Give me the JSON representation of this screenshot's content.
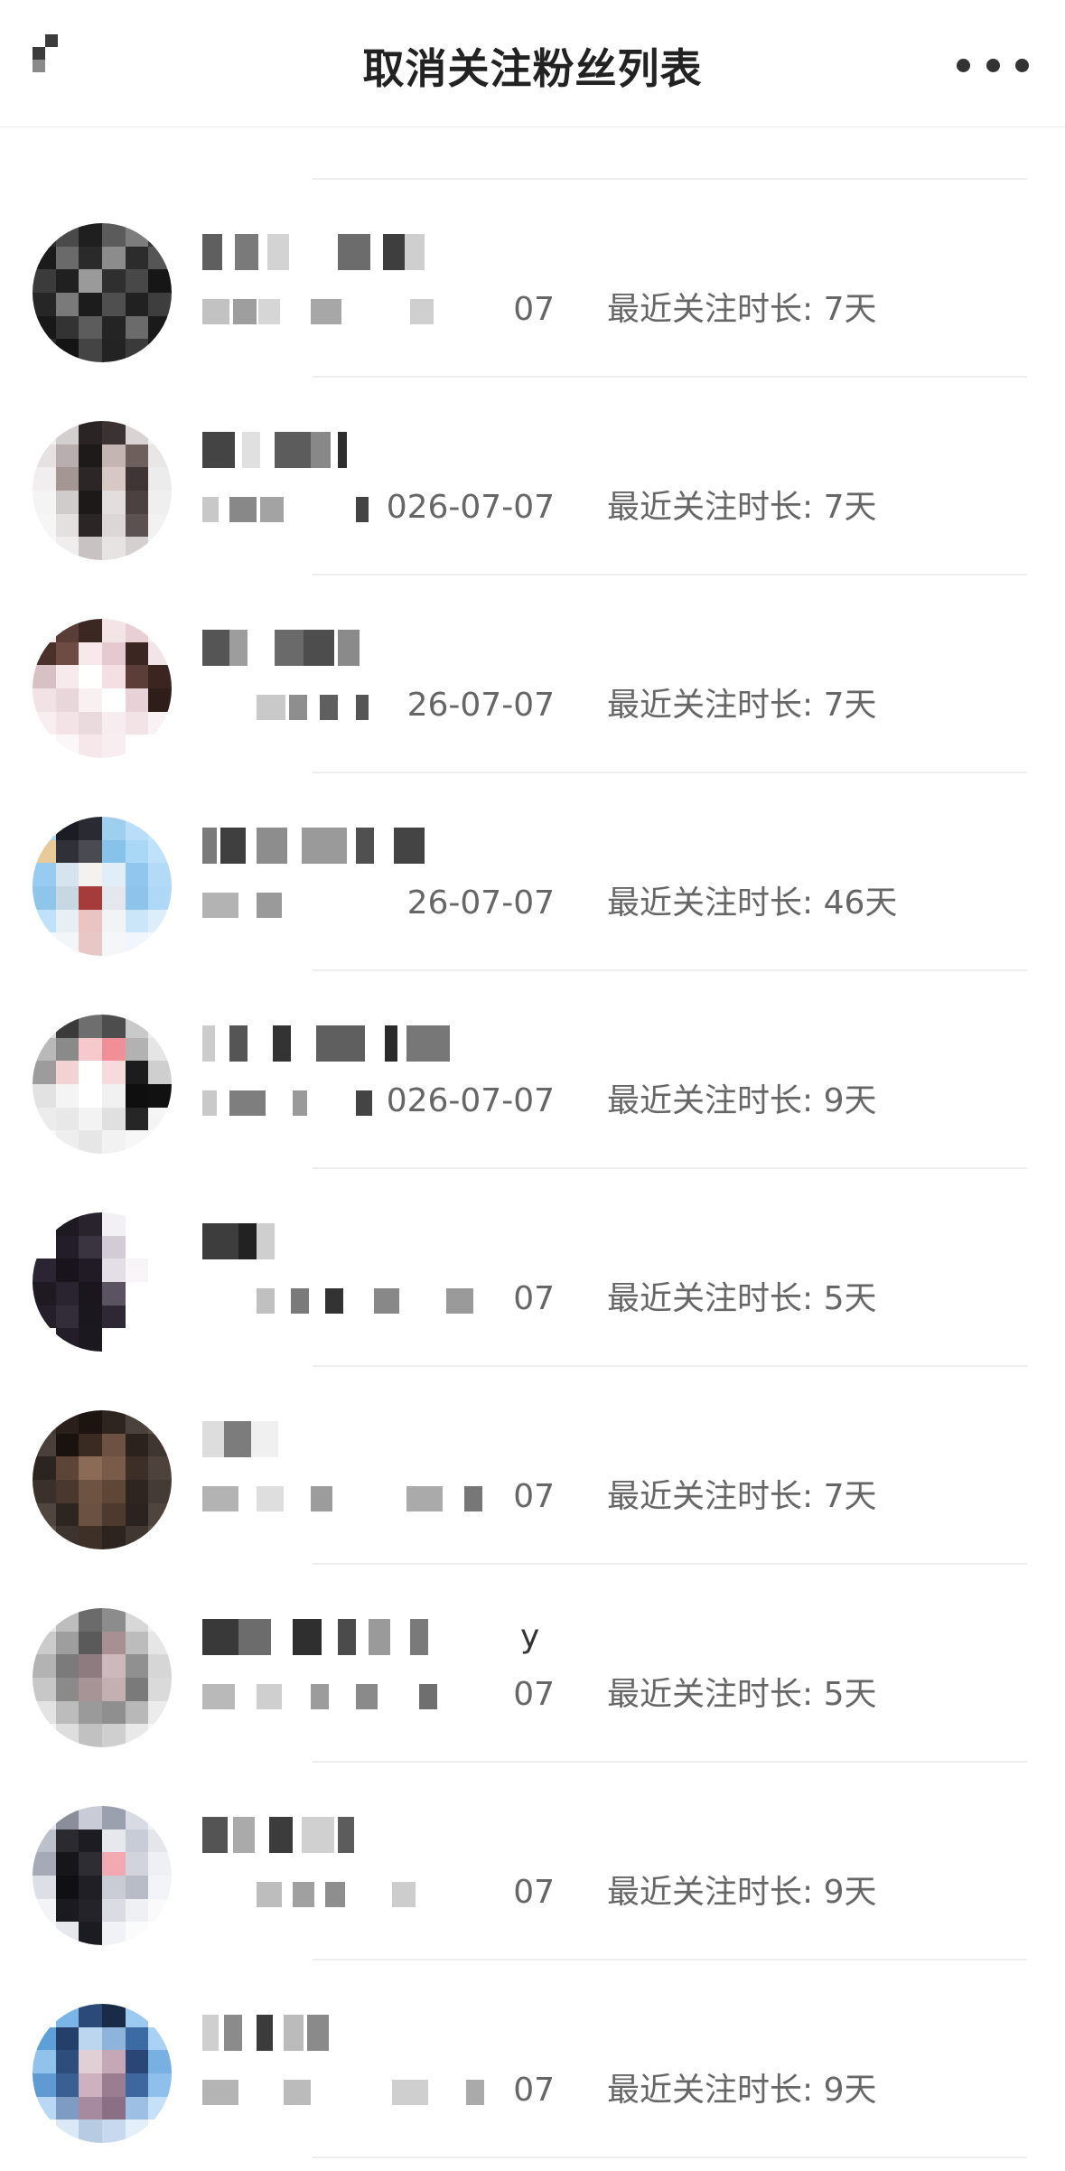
{
  "header": {
    "title": "取消关注粉丝列表"
  },
  "follow_label": "最近关注时长: ",
  "rows": [
    {
      "date": "",
      "days": "",
      "name_tail": "",
      "avatar": [
        "#f3e9f1",
        "#e8c6dc",
        "#d9a6c8",
        "#cfa5c3",
        "#f1dbe9",
        "#ffffff",
        "#f0d8e6",
        "#e22e86",
        "#d7a4c8",
        "#cba0c0",
        "#e6c6db",
        "#ffffff",
        "#ffffff",
        "#ffffff",
        "#ffffff",
        "#ffffff",
        "#ffffff",
        "#ffffff",
        "#ffffff",
        "#ffffff",
        "#ffffff",
        "#ffffff",
        "#ffffff",
        "#ffffff",
        "#ffffff",
        "#ffffff",
        "#ffffff",
        "#ffffff",
        "#ffffff",
        "#ffffff",
        "#ffffff",
        "#ffffff",
        "#ffffff",
        "#ffffff",
        "#ffffff",
        "#ffffff"
      ]
    },
    {
      "date": "07",
      "days": "7天",
      "name_tail": "",
      "avatar": [
        "#2d2d2d",
        "#4a4a4a",
        "#1f1f1f",
        "#5b5b5b",
        "#7d7d7d",
        "#3a3a3a",
        "#1b1b1b",
        "#6a6a6a",
        "#2a2a2a",
        "#8c8c8c",
        "#2c2c2c",
        "#555555",
        "#3b3b3b",
        "#202020",
        "#9a9a9a",
        "#2f2f2f",
        "#484848",
        "#161616",
        "#262626",
        "#7a7a7a",
        "#1c1c1c",
        "#4f4f4f",
        "#212121",
        "#3e3e3e",
        "#181818",
        "#333333",
        "#5c5c5c",
        "#242424",
        "#6b6b6b",
        "#1a1a1a",
        "#2b2b2b",
        "#141414",
        "#444444",
        "#232323",
        "#3a3a3a",
        "#1d1d1d"
      ]
    },
    {
      "date": "026-07-07",
      "days": "7天",
      "name_tail": "",
      "avatar": [
        "#efefef",
        "#d4cfcf",
        "#2a2424",
        "#3b3232",
        "#d9d3d3",
        "#f2f2f2",
        "#e6e2e2",
        "#b9aeae",
        "#1e1a1a",
        "#c4b5b2",
        "#6d5f5c",
        "#e9e6e6",
        "#f0eeee",
        "#a39693",
        "#2d2626",
        "#d7c8c4",
        "#3f3535",
        "#ececec",
        "#f4f4f4",
        "#d1cccc",
        "#1d1919",
        "#e3dede",
        "#4b4141",
        "#efefef",
        "#f6f6f6",
        "#e4e0e0",
        "#2b2525",
        "#dcd6d6",
        "#5c5151",
        "#f2f2f2",
        "#f8f8f8",
        "#efeded",
        "#c9c2c2",
        "#e7e3e3",
        "#d5d0d0",
        "#f5f5f5"
      ]
    },
    {
      "date": "26-07-07",
      "days": "7天",
      "name_tail": "",
      "avatar": [
        "#f5eaea",
        "#5a3d36",
        "#3c2822",
        "#f3e4e6",
        "#e7cfd4",
        "#f9f3f4",
        "#4a302a",
        "#6e4c43",
        "#f6e8eb",
        "#e4c9ce",
        "#3b2621",
        "#f2e5e7",
        "#d8c1c5",
        "#f7eaed",
        "#ffffff",
        "#f4e0e4",
        "#5b3e37",
        "#3a2520",
        "#f1e2e5",
        "#e9d6da",
        "#f9f0f2",
        "#ffffff",
        "#e7d2d7",
        "#2e1d19",
        "#f8eef0",
        "#f4e3e6",
        "#eadade",
        "#f7ecef",
        "#f2e3e6",
        "#f9f1f3",
        "#ffffff",
        "#fbf6f7",
        "#f5e7ea",
        "#f8eef1",
        "#ffffff",
        "#ffffff"
      ]
    },
    {
      "date": "26-07-07",
      "days": "46天",
      "name_tail": "",
      "avatar": [
        "#a7d6f2",
        "#1c1c24",
        "#2a2a33",
        "#9fcfee",
        "#b8defa",
        "#c4e5fb",
        "#e8c99a",
        "#303038",
        "#4a4a52",
        "#87c2ea",
        "#a9d7f6",
        "#bfe2fa",
        "#96ccef",
        "#d6e4ef",
        "#f4f1ef",
        "#e2eef7",
        "#91c7ec",
        "#b3dbf8",
        "#8fc5ea",
        "#c8d8e3",
        "#a73a3a",
        "#e4e8ec",
        "#8ec4ea",
        "#aed8f6",
        "#bfe1f9",
        "#e7eef4",
        "#eac4c2",
        "#f2f3f4",
        "#cbe5f9",
        "#ddeefb",
        "#f2f8fd",
        "#f3f6f9",
        "#e8c8c6",
        "#f4f6f8",
        "#f0f6fb",
        "#f6f9fc"
      ]
    },
    {
      "date": "026-07-07",
      "days": "9天",
      "name_tail": "",
      "avatar": [
        "#dadada",
        "#3a3a3a",
        "#6e6e6e",
        "#4d4d4d",
        "#c9c9c9",
        "#eeeeee",
        "#b9b9b9",
        "#8a8a8a",
        "#f6c9cc",
        "#f08f98",
        "#b2b2b2",
        "#e5e5e5",
        "#9c9c9c",
        "#f3d2d4",
        "#ffffff",
        "#f7dadc",
        "#1c1c1c",
        "#cfcfcf",
        "#e2e2e2",
        "#f4f4f4",
        "#ffffff",
        "#f1f1f1",
        "#0f0f0f",
        "#111111",
        "#ececec",
        "#e8e8e8",
        "#f3f3f3",
        "#e0e0e0",
        "#262626",
        "#f5f5f5",
        "#f9f9f9",
        "#eeeeee",
        "#e6e6e6",
        "#f2f2f2",
        "#f7f7f7",
        "#fbfbfb"
      ]
    },
    {
      "date": "07",
      "days": "5天",
      "name_tail": "",
      "avatar": [
        "#ffffff",
        "#1d1a22",
        "#28232d",
        "#f2f0f3",
        "#ffffff",
        "#ffffff",
        "#ffffff",
        "#221d28",
        "#3a3440",
        "#d3ccd6",
        "#ffffff",
        "#ffffff",
        "#2b2533",
        "#18141c",
        "#201b25",
        "#e4dee6",
        "#f7f5f8",
        "#ffffff",
        "#1e1a22",
        "#2a2430",
        "#1a161d",
        "#5b5361",
        "#ffffff",
        "#ffffff",
        "#241f29",
        "#332c39",
        "#1b171f",
        "#2e2834",
        "#ffffff",
        "#ffffff",
        "#ffffff",
        "#221d27",
        "#1c181f",
        "#ffffff",
        "#ffffff",
        "#ffffff"
      ]
    },
    {
      "date": "07",
      "days": "7天",
      "name_tail": "",
      "avatar": [
        "#3d3530",
        "#2a1f1a",
        "#1c1410",
        "#2e2420",
        "#4b423d",
        "#5a504a",
        "#4a3f39",
        "#1a120e",
        "#3a2a22",
        "#6d5142",
        "#2c221d",
        "#3f3631",
        "#2c2420",
        "#5c4436",
        "#8b6a56",
        "#7a5b49",
        "#3b2f28",
        "#4d423c",
        "#3a312c",
        "#4a372d",
        "#6e5343",
        "#5f4738",
        "#2f2520",
        "#453b35",
        "#51463f",
        "#2d2520",
        "#6a5141",
        "#4d3a2f",
        "#2b2320",
        "#4f443e",
        "#5b504a",
        "#3d3430",
        "#3e2f27",
        "#2d2420",
        "#403632",
        "#5c524c"
      ]
    },
    {
      "date": "07",
      "days": "5天",
      "name_tail": "y",
      "avatar": [
        "#e9e9e9",
        "#bdbdbd",
        "#6b6b6b",
        "#8c8c8c",
        "#d7d7d7",
        "#f3f3f3",
        "#cbcbcb",
        "#9e9e9e",
        "#5a5a5a",
        "#a78f93",
        "#bcbcbc",
        "#e6e6e6",
        "#b3b3b3",
        "#7b7b7b",
        "#8d7b7f",
        "#cdb9bc",
        "#909090",
        "#d6d6d6",
        "#c7c7c7",
        "#8a8a8a",
        "#a69497",
        "#c4afb3",
        "#7a7a7a",
        "#dadada",
        "#e3e3e3",
        "#bcbcbc",
        "#9a9a9a",
        "#8f8f8f",
        "#b8b8b8",
        "#ececec",
        "#f5f5f5",
        "#dedede",
        "#c1c1c1",
        "#cfcfcf",
        "#e9e9e9",
        "#f7f7f7"
      ]
    },
    {
      "date": "07",
      "days": "9天",
      "name_tail": "",
      "avatar": [
        "#e6e6ec",
        "#8a8e9a",
        "#c9ccd6",
        "#9aa0ae",
        "#d8dbe3",
        "#f2f3f6",
        "#bcc0ca",
        "#2a2a30",
        "#1c1c22",
        "#e6e8ee",
        "#c8ccd6",
        "#e4e6ec",
        "#a6aab6",
        "#15151a",
        "#2d2d33",
        "#f3a9b2",
        "#d1d4dc",
        "#eef0f4",
        "#dcdfe6",
        "#101014",
        "#1f1f25",
        "#c9ccd4",
        "#b8bcc6",
        "#f3f4f7",
        "#f3f4f7",
        "#1a1a20",
        "#232329",
        "#d9dce3",
        "#eef0f3",
        "#fafafb",
        "#fafafb",
        "#e5e7ec",
        "#1b1b21",
        "#f1f2f5",
        "#fbfbfc",
        "#ffffff"
      ]
    },
    {
      "date": "07",
      "days": "9天",
      "name_tail": "",
      "avatar": [
        "#ffffff",
        "#7bb4e6",
        "#2b4a78",
        "#1a2b47",
        "#9cc9ef",
        "#ffffff",
        "#5f9fd8",
        "#233f6a",
        "#bcd6f0",
        "#8eb4dc",
        "#3c6aa3",
        "#a9d1f3",
        "#91c2ec",
        "#2d4e7d",
        "#e1cfd6",
        "#c4a8b6",
        "#2a4674",
        "#78b0e2",
        "#5f9ad2",
        "#3a5f91",
        "#cdb1bf",
        "#9a7e90",
        "#3e67a0",
        "#8fc0ec",
        "#b9d8f5",
        "#7e9cc3",
        "#a58aa0",
        "#8a6f85",
        "#9dbfe4",
        "#c6e0f7",
        "#ffffff",
        "#dbe9f7",
        "#b7cbe2",
        "#c6d9ee",
        "#e3eff9",
        "#ffffff"
      ]
    }
  ]
}
